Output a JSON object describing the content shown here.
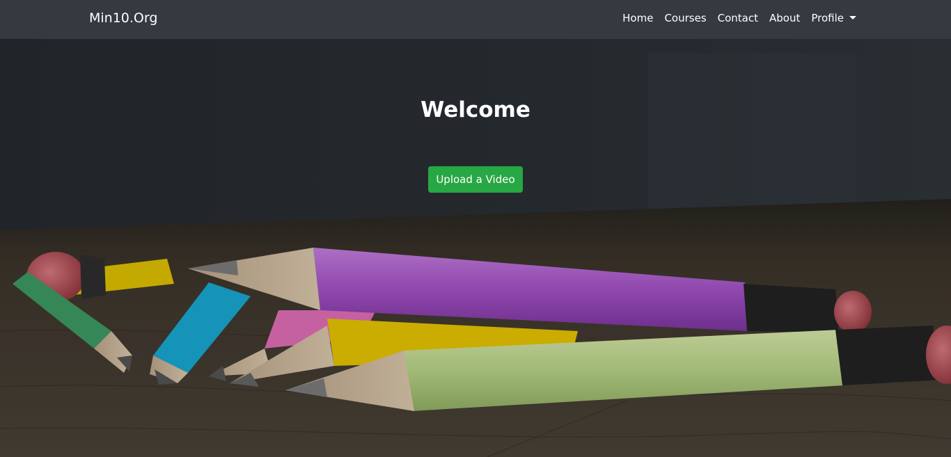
{
  "navbar": {
    "brand": "Min10.Org",
    "links": [
      "Home",
      "Courses",
      "Contact",
      "About",
      "Profile"
    ]
  },
  "hero": {
    "title": "Welcome",
    "button_label": "Upload a Video",
    "image_subject": "colored pencils on wooden table"
  },
  "colors": {
    "navbar": "#343a40",
    "button": "#28a745",
    "text": "#ffffff"
  }
}
